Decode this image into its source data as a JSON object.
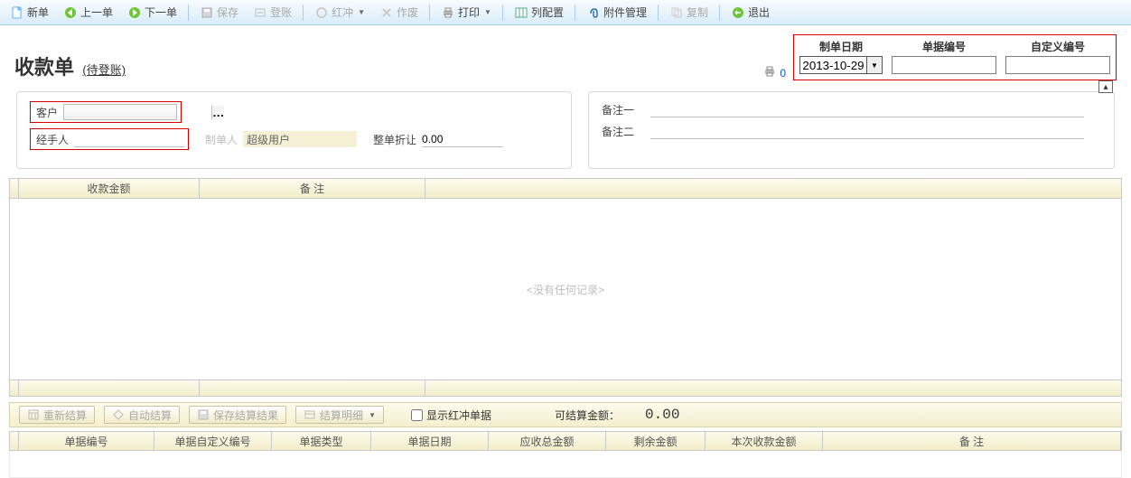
{
  "toolbar": {
    "new": "新单",
    "prev": "上一单",
    "next": "下一单",
    "save": "保存",
    "post": "登账",
    "red": "红冲",
    "void": "作废",
    "print": "打印",
    "colcfg": "列配置",
    "attach": "附件管理",
    "copy": "复制",
    "exit": "退出"
  },
  "title": {
    "main": "收款单",
    "sub": "(待登账)"
  },
  "head": {
    "date_label": "制单日期",
    "date_value": "2013-10-29",
    "no_label": "单据编号",
    "cust_label": "自定义编号",
    "mini_print_count": "0"
  },
  "form": {
    "customer_label": "客户",
    "handler_label": "经手人",
    "maker_label": "制单人",
    "maker_value": "超级用户",
    "discount_label": "整单折让",
    "discount_value": "0.00",
    "remark1_label": "备注一",
    "remark2_label": "备注二"
  },
  "grid_top": {
    "cols": [
      "收款金额",
      "备 注"
    ],
    "empty": "<没有任何记录>"
  },
  "action": {
    "recalc": "重新结算",
    "auto": "自动结算",
    "saveres": "保存结算结果",
    "detail": "结算明细",
    "show_red": "显示红冲单据",
    "avail_label": "可结算金额：",
    "avail_value": "0.00"
  },
  "grid_bottom": {
    "cols": [
      "单据编号",
      "单据自定义编号",
      "单据类型",
      "单据日期",
      "应收总金额",
      "剩余金额",
      "本次收款金额",
      "备 注"
    ]
  }
}
